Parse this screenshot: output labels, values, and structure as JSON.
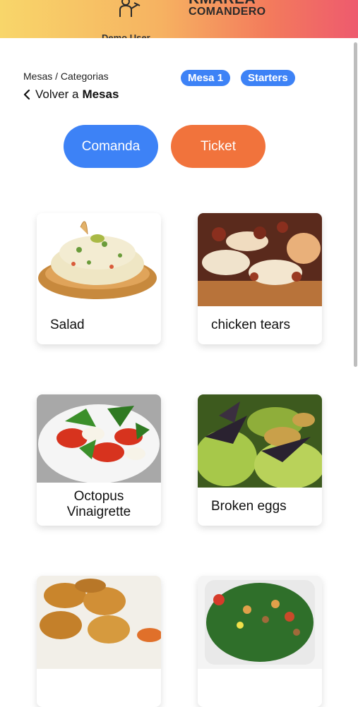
{
  "header": {
    "brand_line1": "KMAREA",
    "brand_line2": "COMANDERO",
    "user_name": "Demo User"
  },
  "nav": {
    "breadcrumb": "Mesas / Categorias",
    "back_prefix": "Volver a",
    "back_target": "Mesas"
  },
  "badges": {
    "mesa": "Mesa 1",
    "category": "Starters"
  },
  "actions": {
    "comanda": "Comanda",
    "ticket": "Ticket"
  },
  "products": [
    {
      "name": "Salad"
    },
    {
      "name": "chicken tears"
    },
    {
      "name": "Octopus Vinaigrette"
    },
    {
      "name": "Broken eggs"
    },
    {
      "name": ""
    },
    {
      "name": ""
    }
  ],
  "colors": {
    "primary": "#3d82f6",
    "ticket": "#f1733c",
    "header_gradient_start": "#f8d66a",
    "header_gradient_end": "#ee5a6e"
  }
}
